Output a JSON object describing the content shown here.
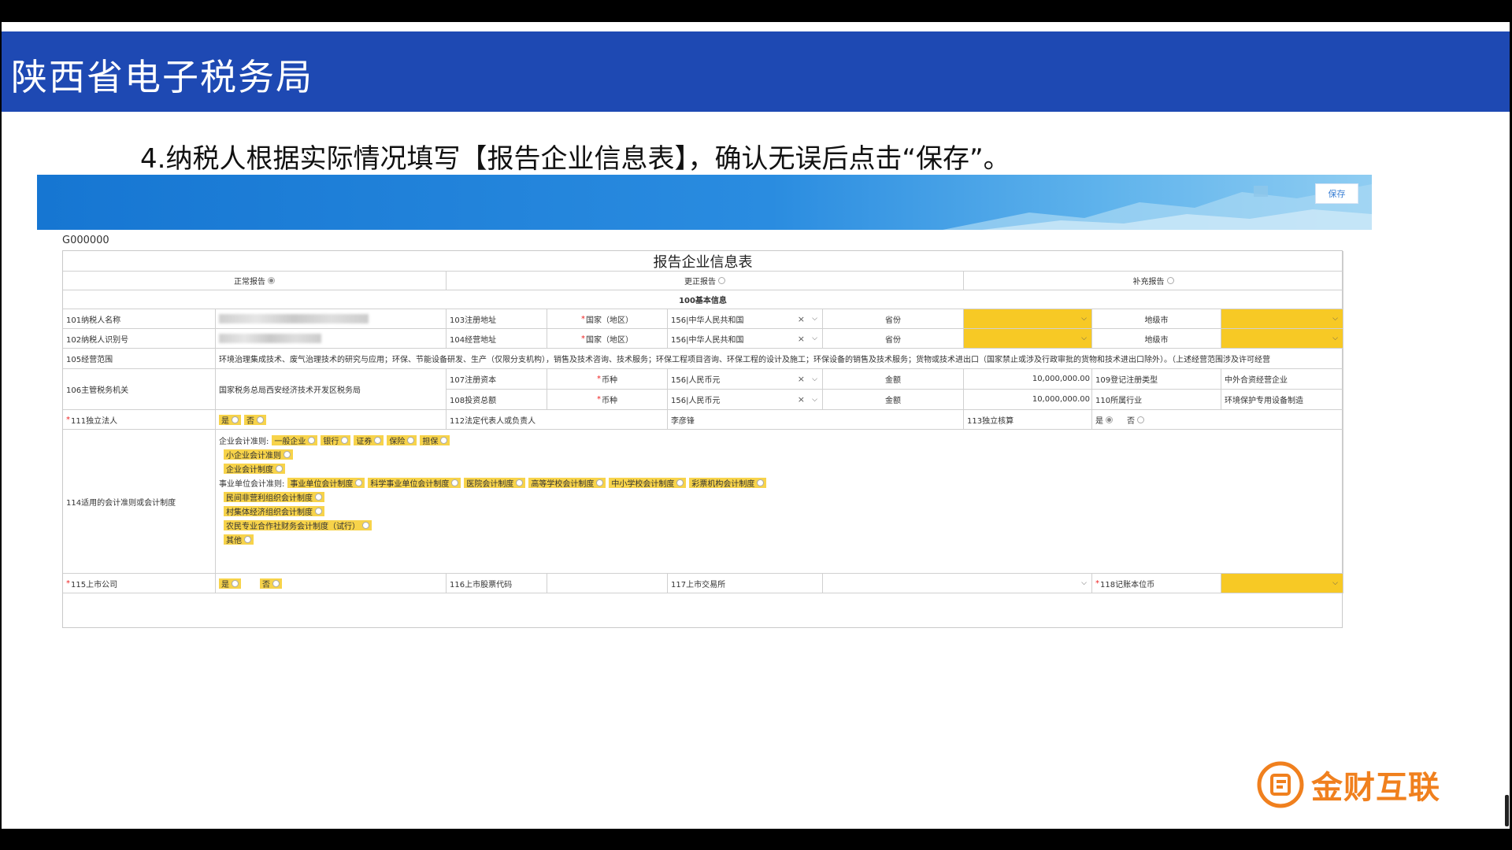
{
  "slide": {
    "title": "陕西省电子税务局",
    "instruction": "4.纳税人根据实际情况填写【报告企业信息表】，确认无误后点击“保存”。",
    "brand": "金财互联"
  },
  "toolbar": {
    "save_label": "保存"
  },
  "form": {
    "id": "G000000",
    "title": "报告企业信息表",
    "report_types": [
      {
        "label": "正常报告",
        "selected": true
      },
      {
        "label": "更正报告",
        "selected": false
      },
      {
        "label": "补充报告",
        "selected": false
      }
    ],
    "section_basic": "100基本信息",
    "f101_label": "101纳税人名称",
    "f102_label": "102纳税人识别号",
    "f103_label": "103注册地址",
    "f104_label": "104经营地址",
    "country_label": "国家（地区）",
    "country_value": "156|中华人民共和国",
    "province_label": "省份",
    "city_label": "地级市",
    "f105_label": "105经营范围",
    "f105_value": "环境治理集成技术、废气治理技术的研究与应用；环保、节能设备研发、生产（仅限分支机构），销售及技术咨询、技术服务；环保工程项目咨询、环保工程的设计及施工；环保设备的销售及技术服务；货物或技术进出口（国家禁止或涉及行政审批的货物和技术进出口除外）。（上述经营范围涉及许可经营",
    "f106_label": "106主管税务机关",
    "f106_value": "国家税务总局西安经济技术开发区税务局",
    "f107_label": "107注册资本",
    "f108_label": "108投资总额",
    "currency_label": "币种",
    "currency_value": "156|人民币元",
    "amount_label": "金额",
    "f107_amount": "10,000,000.00",
    "f108_amount": "10,000,000.00",
    "f109_label": "109登记注册类型",
    "f109_value": "中外合资经营企业",
    "f110_label": "110所属行业",
    "f110_value": "环境保护专用设备制造",
    "f111_label": "111独立法人",
    "yes": "是",
    "no": "否",
    "f112_label": "112法定代表人或负责人",
    "f112_value": "李彦锋",
    "f113_label": "113独立核算",
    "f114_label": "114适用的会计准则或会计制度",
    "enterprise_standards_label": "企业会计准则:",
    "enterprise_standards": [
      "一般企业",
      "银行",
      "证券",
      "保险",
      "担保"
    ],
    "small_enterprise": "小企业会计准则",
    "enterprise_system": "企业会计制度",
    "public_unit_label": "事业单位会计准则:",
    "public_unit_options": [
      "事业单位会计制度",
      "科学事业单位会计制度",
      "医院会计制度",
      "高等学校会计制度",
      "中小学校会计制度",
      "彩票机构会计制度"
    ],
    "nonprofit": "民间非营利组织会计制度",
    "village": "村集体经济组织会计制度",
    "coop": "农民专业合作社财务会计制度（试行）",
    "other": "其他",
    "f115_label": "115上市公司",
    "f116_label": "116上市股票代码",
    "f117_label": "117上市交易所",
    "f118_label": "118记账本位币"
  },
  "colors": {
    "title_bar": "#1e49b3",
    "highlight": "#f7c925",
    "brand": "#f0801e"
  }
}
